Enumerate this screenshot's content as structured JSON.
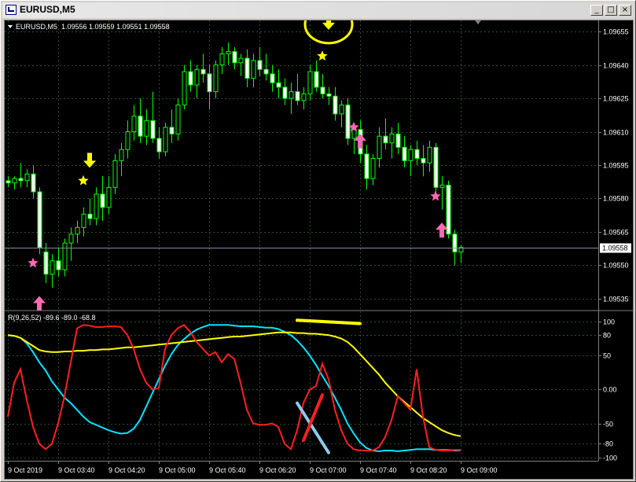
{
  "window": {
    "title": "EURUSD,M5",
    "buttons": {
      "minimize": "_",
      "maximize": "□",
      "close": "×"
    }
  },
  "colors": {
    "background": "#000000",
    "grid": "#2e4d2e",
    "candle": "#00ff00",
    "current_price_line": "#8a8aa0",
    "stoch_main": "#00e5ff",
    "stoch_signal": "#ffff00",
    "rsi": "#ff2020",
    "star_yellow": "#ffff00",
    "star_pink": "#ff69b4",
    "arrow_yellow": "#ffff00",
    "arrow_pink": "#ff69b4"
  },
  "chart_data": [
    {
      "type": "candlestick",
      "symbol_label": "EURUSD,M5",
      "ohlc_label": "1.09556 1.09559 1.09551 1.09558",
      "current_price": "1.09558",
      "ylim": [
        1.0953,
        1.0966
      ],
      "y_ticks": [
        "1.09655",
        "1.09640",
        "1.09625",
        "1.09610",
        "1.09595",
        "1.09580",
        "1.09565",
        "1.09550",
        "1.09535"
      ],
      "candles": [
        [
          1.09588,
          1.0959,
          1.09585,
          1.09587
        ],
        [
          1.09587,
          1.0959,
          1.09584,
          1.09589
        ],
        [
          1.09589,
          1.09596,
          1.09585,
          1.09588
        ],
        [
          1.09588,
          1.09593,
          1.09585,
          1.09591
        ],
        [
          1.09591,
          1.09595,
          1.0958,
          1.09583
        ],
        [
          1.09583,
          1.09585,
          1.09555,
          1.09558
        ],
        [
          1.09556,
          1.0956,
          1.09542,
          1.09546
        ],
        [
          1.09546,
          1.09555,
          1.0954,
          1.09552
        ],
        [
          1.09552,
          1.09558,
          1.09545,
          1.09548
        ],
        [
          1.09548,
          1.09562,
          1.09545,
          1.0956
        ],
        [
          1.0956,
          1.09567,
          1.09552,
          1.09564
        ],
        [
          1.09564,
          1.0957,
          1.0956,
          1.09567
        ],
        [
          1.09567,
          1.09576,
          1.09563,
          1.09573
        ],
        [
          1.09573,
          1.0958,
          1.09568,
          1.09571
        ],
        [
          1.09571,
          1.09585,
          1.09568,
          1.09582
        ],
        [
          1.09582,
          1.0959,
          1.0957,
          1.09576
        ],
        [
          1.09576,
          1.0959,
          1.09573,
          1.09585
        ],
        [
          1.09585,
          1.096,
          1.09582,
          1.09597
        ],
        [
          1.09597,
          1.09605,
          1.0959,
          1.09602
        ],
        [
          1.09602,
          1.09615,
          1.09598,
          1.0961
        ],
        [
          1.0961,
          1.09622,
          1.09606,
          1.09617
        ],
        [
          1.09617,
          1.09625,
          1.09605,
          1.09608
        ],
        [
          1.09608,
          1.0962,
          1.09604,
          1.09615
        ],
        [
          1.09615,
          1.09628,
          1.09605,
          1.09607
        ],
        [
          1.09607,
          1.09612,
          1.09598,
          1.09601
        ],
        [
          1.09601,
          1.09614,
          1.09599,
          1.09612
        ],
        [
          1.09612,
          1.0962,
          1.09605,
          1.09609
        ],
        [
          1.09609,
          1.09625,
          1.09606,
          1.09622
        ],
        [
          1.09622,
          1.0964,
          1.0962,
          1.09637
        ],
        [
          1.09637,
          1.09642,
          1.09628,
          1.09631
        ],
        [
          1.09631,
          1.0964,
          1.09625,
          1.09638
        ],
        [
          1.09638,
          1.09645,
          1.09632,
          1.09636
        ],
        [
          1.09636,
          1.0964,
          1.0962,
          1.09628
        ],
        [
          1.09628,
          1.09642,
          1.09625,
          1.0964
        ],
        [
          1.0964,
          1.09648,
          1.09636,
          1.09645
        ],
        [
          1.09645,
          1.0965,
          1.0964,
          1.09646
        ],
        [
          1.09646,
          1.09648,
          1.09638,
          1.09641
        ],
        [
          1.09641,
          1.09645,
          1.09635,
          1.09643
        ],
        [
          1.09643,
          1.09647,
          1.0963,
          1.09634
        ],
        [
          1.09634,
          1.09645,
          1.0963,
          1.09642
        ],
        [
          1.09642,
          1.09648,
          1.09635,
          1.09638
        ],
        [
          1.09638,
          1.09645,
          1.09633,
          1.09636
        ],
        [
          1.09636,
          1.0964,
          1.09628,
          1.09632
        ],
        [
          1.09632,
          1.09638,
          1.09625,
          1.0963
        ],
        [
          1.0963,
          1.09634,
          1.09622,
          1.09625
        ],
        [
          1.09625,
          1.09632,
          1.09618,
          1.09628
        ],
        [
          1.09628,
          1.09636,
          1.09622,
          1.09624
        ],
        [
          1.09624,
          1.0963,
          1.0962,
          1.09627
        ],
        [
          1.09627,
          1.0964,
          1.09624,
          1.09637
        ],
        [
          1.09637,
          1.09642,
          1.09628,
          1.0963
        ],
        [
          1.0963,
          1.09636,
          1.09625,
          1.09627
        ],
        [
          1.09627,
          1.0963,
          1.09622,
          1.09626
        ],
        [
          1.09626,
          1.0963,
          1.09615,
          1.09618
        ],
        [
          1.09618,
          1.09624,
          1.09612,
          1.09622
        ],
        [
          1.09622,
          1.09625,
          1.09604,
          1.09607
        ],
        [
          1.09607,
          1.09614,
          1.096,
          1.09611
        ],
        [
          1.09611,
          1.09615,
          1.09596,
          1.096
        ],
        [
          1.096,
          1.09604,
          1.09584,
          1.09589
        ],
        [
          1.09589,
          1.096,
          1.09586,
          1.09598
        ],
        [
          1.09598,
          1.09612,
          1.09594,
          1.09608
        ],
        [
          1.09608,
          1.09616,
          1.09602,
          1.09605
        ],
        [
          1.09605,
          1.09612,
          1.09598,
          1.09609
        ],
        [
          1.09609,
          1.09614,
          1.096,
          1.09603
        ],
        [
          1.09603,
          1.09608,
          1.09594,
          1.09597
        ],
        [
          1.09597,
          1.09604,
          1.0959,
          1.09602
        ],
        [
          1.09602,
          1.09606,
          1.09595,
          1.09598
        ],
        [
          1.09598,
          1.09604,
          1.0959,
          1.09596
        ],
        [
          1.09596,
          1.09606,
          1.09592,
          1.09603
        ],
        [
          1.09603,
          1.09605,
          1.0958,
          1.09585
        ],
        [
          1.09585,
          1.0959,
          1.09575,
          1.09586
        ],
        [
          1.09586,
          1.09588,
          1.09562,
          1.09564
        ],
        [
          1.09564,
          1.09566,
          1.0955,
          1.09556
        ],
        [
          1.09556,
          1.09559,
          1.09551,
          1.09558
        ]
      ],
      "markers": [
        {
          "kind": "star",
          "color": "pink",
          "bar": 4,
          "price": 1.09551
        },
        {
          "kind": "arrow-up",
          "color": "pink",
          "bar": 5,
          "price": 1.09533
        },
        {
          "kind": "star",
          "color": "yellow",
          "bar": 12,
          "price": 1.09588
        },
        {
          "kind": "arrow-down",
          "color": "yellow",
          "bar": 13,
          "price": 1.09597
        },
        {
          "kind": "star",
          "color": "yellow",
          "bar": 50,
          "price": 1.09644
        },
        {
          "kind": "arrow-down",
          "color": "yellow",
          "bar": 51,
          "price": 1.09659
        },
        {
          "kind": "star",
          "color": "pink",
          "bar": 55,
          "price": 1.09612
        },
        {
          "kind": "arrow-up",
          "color": "pink",
          "bar": 56,
          "price": 1.09606
        },
        {
          "kind": "star",
          "color": "pink",
          "bar": 68,
          "price": 1.09581
        },
        {
          "kind": "arrow-up",
          "color": "pink",
          "bar": 69,
          "price": 1.09566
        }
      ]
    },
    {
      "type": "line",
      "indicator_label": "R(9,26,52) -89.6 -89.0 -68.8",
      "ylim": [
        -105,
        115
      ],
      "y_ticks": [
        "100",
        "80",
        "50",
        "0.00",
        "-50",
        "-80",
        "-100"
      ],
      "series": [
        {
          "color": "cyan",
          "values": [
            80,
            79,
            76,
            68,
            55,
            40,
            28,
            12,
            0,
            -12,
            -20,
            -30,
            -40,
            -48,
            -52,
            -56,
            -60,
            -63,
            -65,
            -64,
            -58,
            -45,
            -25,
            -5,
            15,
            35,
            52,
            65,
            74,
            82,
            88,
            92,
            95,
            95,
            95,
            95,
            94,
            93,
            93,
            93,
            92,
            91,
            91,
            89,
            85,
            80,
            72,
            62,
            50,
            36,
            20,
            5,
            -12,
            -30,
            -50,
            -65,
            -78,
            -86,
            -90,
            -91,
            -90,
            -90,
            -91,
            -90,
            -89,
            -88,
            -88,
            -88,
            -89,
            -89,
            -89,
            -90,
            -89.6
          ]
        },
        {
          "color": "yellow",
          "values": [
            80,
            79,
            76,
            70,
            64,
            58,
            56,
            55,
            55,
            56,
            56,
            57,
            57,
            58,
            58,
            59,
            59,
            60,
            61,
            62,
            62,
            63,
            64,
            65,
            66,
            67,
            68,
            69,
            70,
            71,
            72,
            73,
            74,
            75,
            76,
            77,
            78,
            78,
            79,
            80,
            81,
            82,
            83,
            84,
            84,
            84,
            83,
            83,
            82,
            82,
            81,
            80,
            78,
            75,
            70,
            62,
            52,
            42,
            32,
            22,
            10,
            0,
            -10,
            -18,
            -26,
            -34,
            -42,
            -48,
            -54,
            -60,
            -64,
            -67,
            -68.8
          ]
        },
        {
          "color": "red",
          "values": [
            -40,
            10,
            30,
            -15,
            -55,
            -80,
            -88,
            -80,
            -50,
            -10,
            40,
            90,
            95,
            94,
            92,
            92,
            93,
            93,
            92,
            80,
            60,
            30,
            10,
            0,
            2,
            60,
            80,
            90,
            95,
            85,
            70,
            60,
            50,
            55,
            40,
            52,
            45,
            10,
            -30,
            -50,
            -52,
            -52,
            -50,
            -55,
            -80,
            -88,
            -60,
            -20,
            0,
            5,
            38,
            15,
            -30,
            -60,
            -80,
            -88,
            -90,
            -90,
            -90,
            -85,
            -70,
            -45,
            -10,
            -20,
            -30,
            30,
            -40,
            -85,
            -89,
            -90,
            -90,
            -89,
            -89.0
          ]
        }
      ],
      "annotations": [
        {
          "kind": "trend-line",
          "color": "yellow",
          "from": [
            46,
            102
          ],
          "to": [
            56,
            97
          ]
        },
        {
          "kind": "trend-line",
          "color": "light-blue",
          "from": [
            46,
            -20
          ],
          "to": [
            51,
            -93
          ]
        },
        {
          "kind": "trend-line",
          "color": "red",
          "from": [
            47,
            -75
          ],
          "to": [
            50,
            -8
          ]
        }
      ]
    }
  ],
  "time_axis": [
    "9 Oct 2019",
    "9 Oct 03:40",
    "9 Oct 04:20",
    "9 Oct 05:00",
    "9 Oct 05:40",
    "9 Oct 06:20",
    "9 Oct 07:00",
    "9 Oct 07:40",
    "9 Oct 08:20",
    "9 Oct 09:00"
  ]
}
